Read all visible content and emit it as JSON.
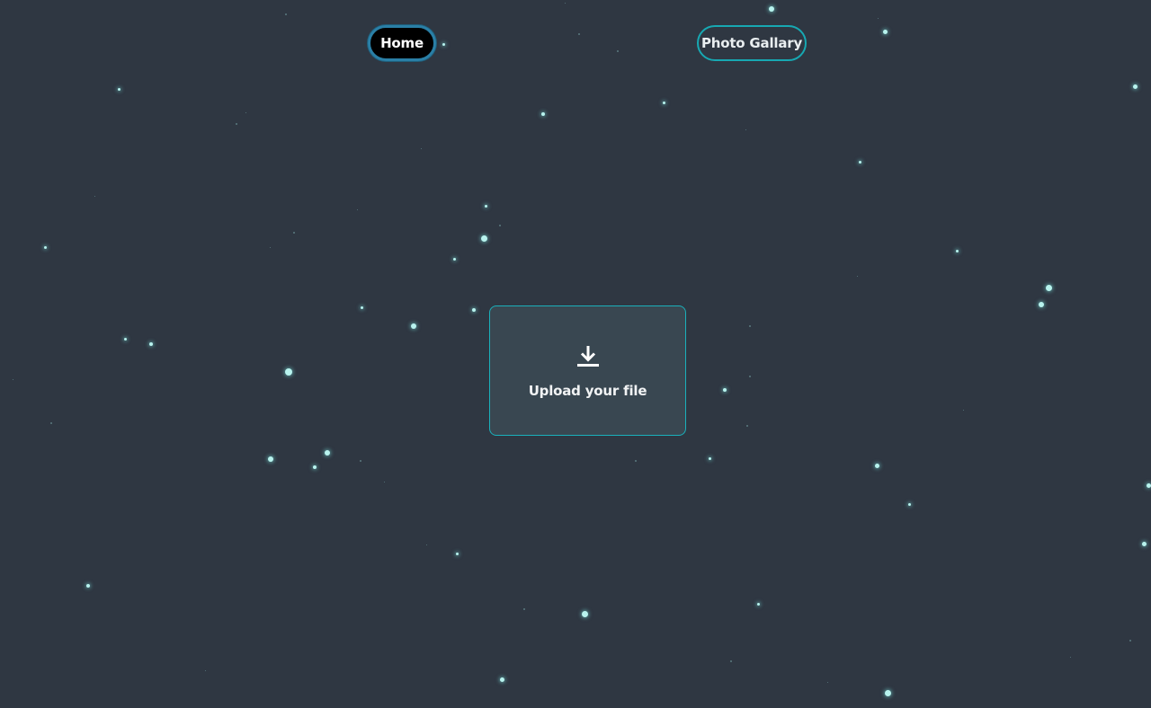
{
  "nav": {
    "home_label": "Home",
    "gallery_label": "Photo Gallary"
  },
  "upload": {
    "label": "Upload your file",
    "icon": "download-icon"
  },
  "colors": {
    "background": "#2f3742",
    "accent": "#17a8b2",
    "home_button": "#000000",
    "home_border": "#2a7fa6",
    "upload_panel": "#394751",
    "star": "#b8f3ee"
  }
}
